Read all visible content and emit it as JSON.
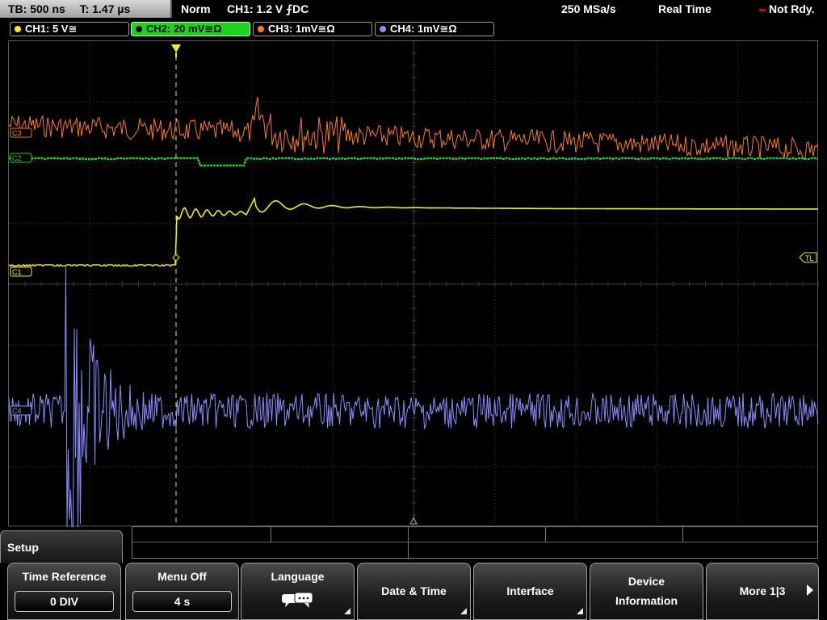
{
  "topbar": {
    "timebase": "TB: 500 ns",
    "trigger_time": "T: 1.47 µs",
    "trigger_mode": "Norm",
    "trigger_desc": "CH1: 1.2 V ⨍DC",
    "sample_rate": "250 MSa/s",
    "acquisition_mode": "Real Time",
    "trigger_status": "Not Rdy."
  },
  "channels": [
    {
      "label": "CH1: 5 V≅",
      "color": "#f2f200"
    },
    {
      "label": "CH2: 20 mV≅Ω",
      "color": "#1ed21e"
    },
    {
      "label": "CH3: 1mV≅Ω",
      "color": "#ff7a20"
    },
    {
      "label": "CH4: 1mV≅Ω",
      "color": "#8c8cff"
    }
  ],
  "markers": {
    "c3": "C3",
    "c2": "C2",
    "c1": "C1",
    "c4": "C4",
    "trigger_level": "TL"
  },
  "setup": {
    "title": "Setup"
  },
  "softkeys": {
    "time_reference": {
      "label": "Time Reference",
      "value": "0 DIV"
    },
    "menu_off": {
      "label": "Menu Off",
      "value": "4 s"
    },
    "language": {
      "label": "Language",
      "icon": "speech-bubbles-icon"
    },
    "date_time": {
      "label": "Date & Time"
    },
    "interface": {
      "label": "Interface"
    },
    "device_information": {
      "line1": "Device",
      "line2": "Information"
    },
    "more": {
      "label": "More 1|3"
    }
  },
  "colors": {
    "grid": "#3c3c3c",
    "ch1": "#f2f200",
    "ch2": "#1ed21e",
    "ch3": "#ff7a20",
    "ch4": "#8c8cff"
  }
}
